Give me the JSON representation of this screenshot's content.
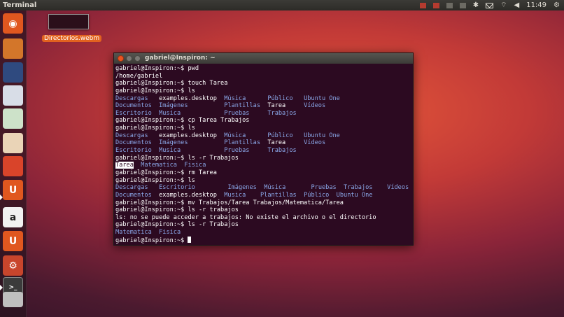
{
  "top_panel": {
    "app_title": "Terminal",
    "clock": "11:49"
  },
  "desktop": {
    "file_label": "Directorios.webm"
  },
  "launcher": {
    "items": [
      {
        "name": "dash-home-icon",
        "glyph": "◉",
        "bg": "#e0571f"
      },
      {
        "name": "files-icon",
        "glyph": "",
        "bg": "#d3762a"
      },
      {
        "name": "firefox-icon",
        "glyph": "",
        "bg": "#2f4a7f"
      },
      {
        "name": "writer-icon",
        "glyph": "",
        "bg": "#d8dde7"
      },
      {
        "name": "calc-icon",
        "glyph": "",
        "bg": "#cde2c9"
      },
      {
        "name": "impress-icon",
        "glyph": "",
        "bg": "#ead4b7"
      },
      {
        "name": "software-center-icon",
        "glyph": "",
        "bg": "#d9442a"
      },
      {
        "name": "ubuntu-one-icon",
        "glyph": "U",
        "bg": "#e0571f"
      },
      {
        "name": "amazon-icon",
        "glyph": "a",
        "bg": "#f1f1f1"
      },
      {
        "name": "ubuntu-one-music-icon",
        "glyph": "U",
        "bg": "#e0571f"
      },
      {
        "name": "system-settings-icon",
        "glyph": "⚙",
        "bg": "#c8452c"
      },
      {
        "name": "terminal-icon",
        "glyph": ">_",
        "bg": "#3b3b3b"
      },
      {
        "name": "workspaces-icon",
        "glyph": "",
        "bg": "#bfbfbf"
      }
    ]
  },
  "terminal": {
    "title": "gabriel@Inspiron: ~",
    "lines": [
      [
        {
          "t": "gabriel@Inspiron:~$ pwd"
        }
      ],
      [
        {
          "t": "/home/gabriel"
        }
      ],
      [
        {
          "t": "gabriel@Inspiron:~$ touch Tarea"
        }
      ],
      [
        {
          "t": "gabriel@Inspiron:~$ ls"
        }
      ],
      [
        {
          "t": "Descargas",
          "c": "dir"
        },
        {
          "t": "   examples.desktop  "
        },
        {
          "t": "Música",
          "c": "dir"
        },
        {
          "t": "      "
        },
        {
          "t": "Público",
          "c": "dir"
        },
        {
          "t": "   "
        },
        {
          "t": "Ubuntu One",
          "c": "dir"
        }
      ],
      [
        {
          "t": "Documentos",
          "c": "dir"
        },
        {
          "t": "  "
        },
        {
          "t": "Imágenes",
          "c": "dir"
        },
        {
          "t": "          "
        },
        {
          "t": "Plantillas",
          "c": "dir"
        },
        {
          "t": "  Tarea     "
        },
        {
          "t": "Vídeos",
          "c": "dir"
        }
      ],
      [
        {
          "t": "Escritorio",
          "c": "dir"
        },
        {
          "t": "  "
        },
        {
          "t": "Musica",
          "c": "dir"
        },
        {
          "t": "            "
        },
        {
          "t": "Pruebas",
          "c": "dir"
        },
        {
          "t": "     "
        },
        {
          "t": "Trabajos",
          "c": "dir"
        }
      ],
      [
        {
          "t": "gabriel@Inspiron:~$ cp Tarea Trabajos"
        }
      ],
      [
        {
          "t": "gabriel@Inspiron:~$ ls"
        }
      ],
      [
        {
          "t": "Descargas",
          "c": "dir"
        },
        {
          "t": "   examples.desktop  "
        },
        {
          "t": "Música",
          "c": "dir"
        },
        {
          "t": "      "
        },
        {
          "t": "Público",
          "c": "dir"
        },
        {
          "t": "   "
        },
        {
          "t": "Ubuntu One",
          "c": "dir"
        }
      ],
      [
        {
          "t": "Documentos",
          "c": "dir"
        },
        {
          "t": "  "
        },
        {
          "t": "Imágenes",
          "c": "dir"
        },
        {
          "t": "          "
        },
        {
          "t": "Plantillas",
          "c": "dir"
        },
        {
          "t": "  Tarea     "
        },
        {
          "t": "Vídeos",
          "c": "dir"
        }
      ],
      [
        {
          "t": "Escritorio",
          "c": "dir"
        },
        {
          "t": "  "
        },
        {
          "t": "Musica",
          "c": "dir"
        },
        {
          "t": "            "
        },
        {
          "t": "Pruebas",
          "c": "dir"
        },
        {
          "t": "     "
        },
        {
          "t": "Trabajos",
          "c": "dir"
        }
      ],
      [
        {
          "t": "gabriel@Inspiron:~$ ls -r Trabajos"
        }
      ],
      [
        {
          "t": "Tarea",
          "c": "sel"
        },
        {
          "t": "  "
        },
        {
          "t": "Matematica",
          "c": "dir"
        },
        {
          "t": "  "
        },
        {
          "t": "Fisica",
          "c": "dir"
        }
      ],
      [
        {
          "t": "gabriel@Inspiron:~$ rm Tarea"
        }
      ],
      [
        {
          "t": "gabriel@Inspiron:~$ ls"
        }
      ],
      [
        {
          "t": "Descargas",
          "c": "dir"
        },
        {
          "t": "   "
        },
        {
          "t": "Escritorio",
          "c": "dir"
        },
        {
          "t": "         "
        },
        {
          "t": "Imágenes",
          "c": "dir"
        },
        {
          "t": "  "
        },
        {
          "t": "Música",
          "c": "dir"
        },
        {
          "t": "       "
        },
        {
          "t": "Pruebas",
          "c": "dir"
        },
        {
          "t": "  "
        },
        {
          "t": "Trabajos",
          "c": "dir"
        },
        {
          "t": "    "
        },
        {
          "t": "Vídeos",
          "c": "dir"
        }
      ],
      [
        {
          "t": "Documentos",
          "c": "dir"
        },
        {
          "t": "  examples.desktop  "
        },
        {
          "t": "Musica",
          "c": "dir"
        },
        {
          "t": "    "
        },
        {
          "t": "Plantillas",
          "c": "dir"
        },
        {
          "t": "  "
        },
        {
          "t": "Público",
          "c": "dir"
        },
        {
          "t": "  "
        },
        {
          "t": "Ubuntu One",
          "c": "dir"
        }
      ],
      [
        {
          "t": "gabriel@Inspiron:~$ mv Trabajos/Tarea Trabajos/Matematica/Tarea"
        }
      ],
      [
        {
          "t": "gabriel@Inspiron:~$ ls -r trabajos"
        }
      ],
      [
        {
          "t": "ls: no se puede acceder a trabajos: No existe el archivo o el directorio"
        }
      ],
      [
        {
          "t": "gabriel@Inspiron:~$ ls -r Trabajos"
        }
      ],
      [
        {
          "t": "Matematica",
          "c": "dir"
        },
        {
          "t": "  "
        },
        {
          "t": "Fisica",
          "c": "dir"
        }
      ],
      [
        {
          "t": "gabriel@Inspiron:~$ "
        },
        {
          "cursor": true
        }
      ]
    ]
  }
}
